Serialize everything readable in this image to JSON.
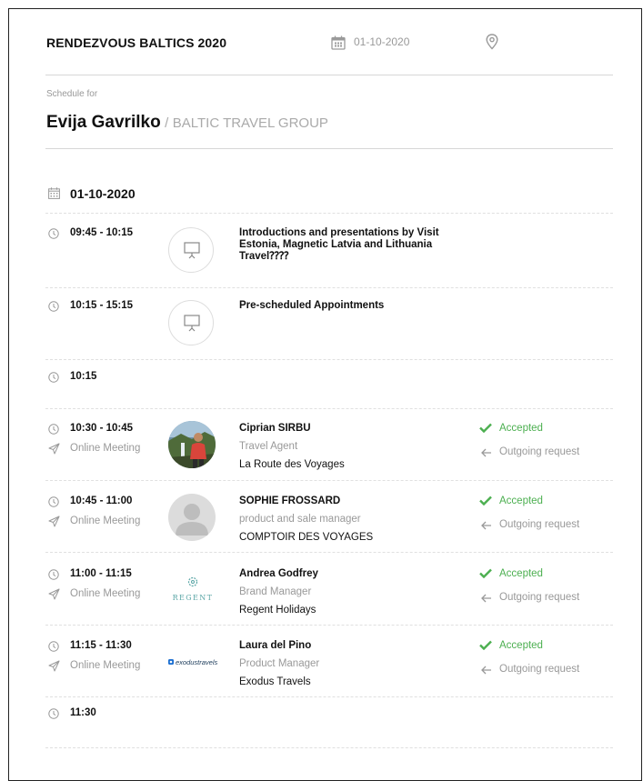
{
  "header": {
    "event_title": "RENDEZVOUS BALTICS 2020",
    "date": "01-10-2020",
    "calendar_icon": "calendar-icon",
    "location_icon": "location-pin-icon"
  },
  "schedule": {
    "label": "Schedule for",
    "person_name": "Evija Gavrilko",
    "separator": "/",
    "company": "BALTIC TRAVEL GROUP"
  },
  "day": {
    "date": "01-10-2020"
  },
  "items": [
    {
      "time": "09:45 - 10:15",
      "title": "Introductions and presentations by Visit Estonia, Magnetic Latvia and Lithuania Travel⁇⁇",
      "icon": "presentation-icon"
    },
    {
      "time": "10:15 - 15:15",
      "title": "Pre-scheduled Appointments",
      "icon": "presentation-icon"
    },
    {
      "time": "10:15"
    },
    {
      "time": "10:30 - 10:45",
      "mode": "Online Meeting",
      "name": "Ciprian SIRBU",
      "role": "Travel Agent",
      "company": "La Route des Voyages",
      "status": "Accepted",
      "request": "Outgoing request",
      "avatar": "photo"
    },
    {
      "time": "10:45 - 11:00",
      "mode": "Online Meeting",
      "name": "SOPHIE FROSSARD",
      "role": "product and sale manager",
      "company": "COMPTOIR DES VOYAGES",
      "status": "Accepted",
      "request": "Outgoing request",
      "avatar": "placeholder"
    },
    {
      "time": "11:00 - 11:15",
      "mode": "Online Meeting",
      "name": "Andrea Godfrey",
      "role": "Brand Manager",
      "company": "Regent Holidays",
      "status": "Accepted",
      "request": "Outgoing request",
      "logo_text": "REGENT"
    },
    {
      "time": "11:15 - 11:30",
      "mode": "Online Meeting",
      "name": "Laura del Pino",
      "role": "Product Manager",
      "company": "Exodus Travels",
      "status": "Accepted",
      "request": "Outgoing request",
      "logo_text": "exodustravels"
    },
    {
      "time": "11:30"
    }
  ],
  "colors": {
    "accepted": "#4caf50",
    "muted": "#999999",
    "divider": "#d6d6d6"
  }
}
